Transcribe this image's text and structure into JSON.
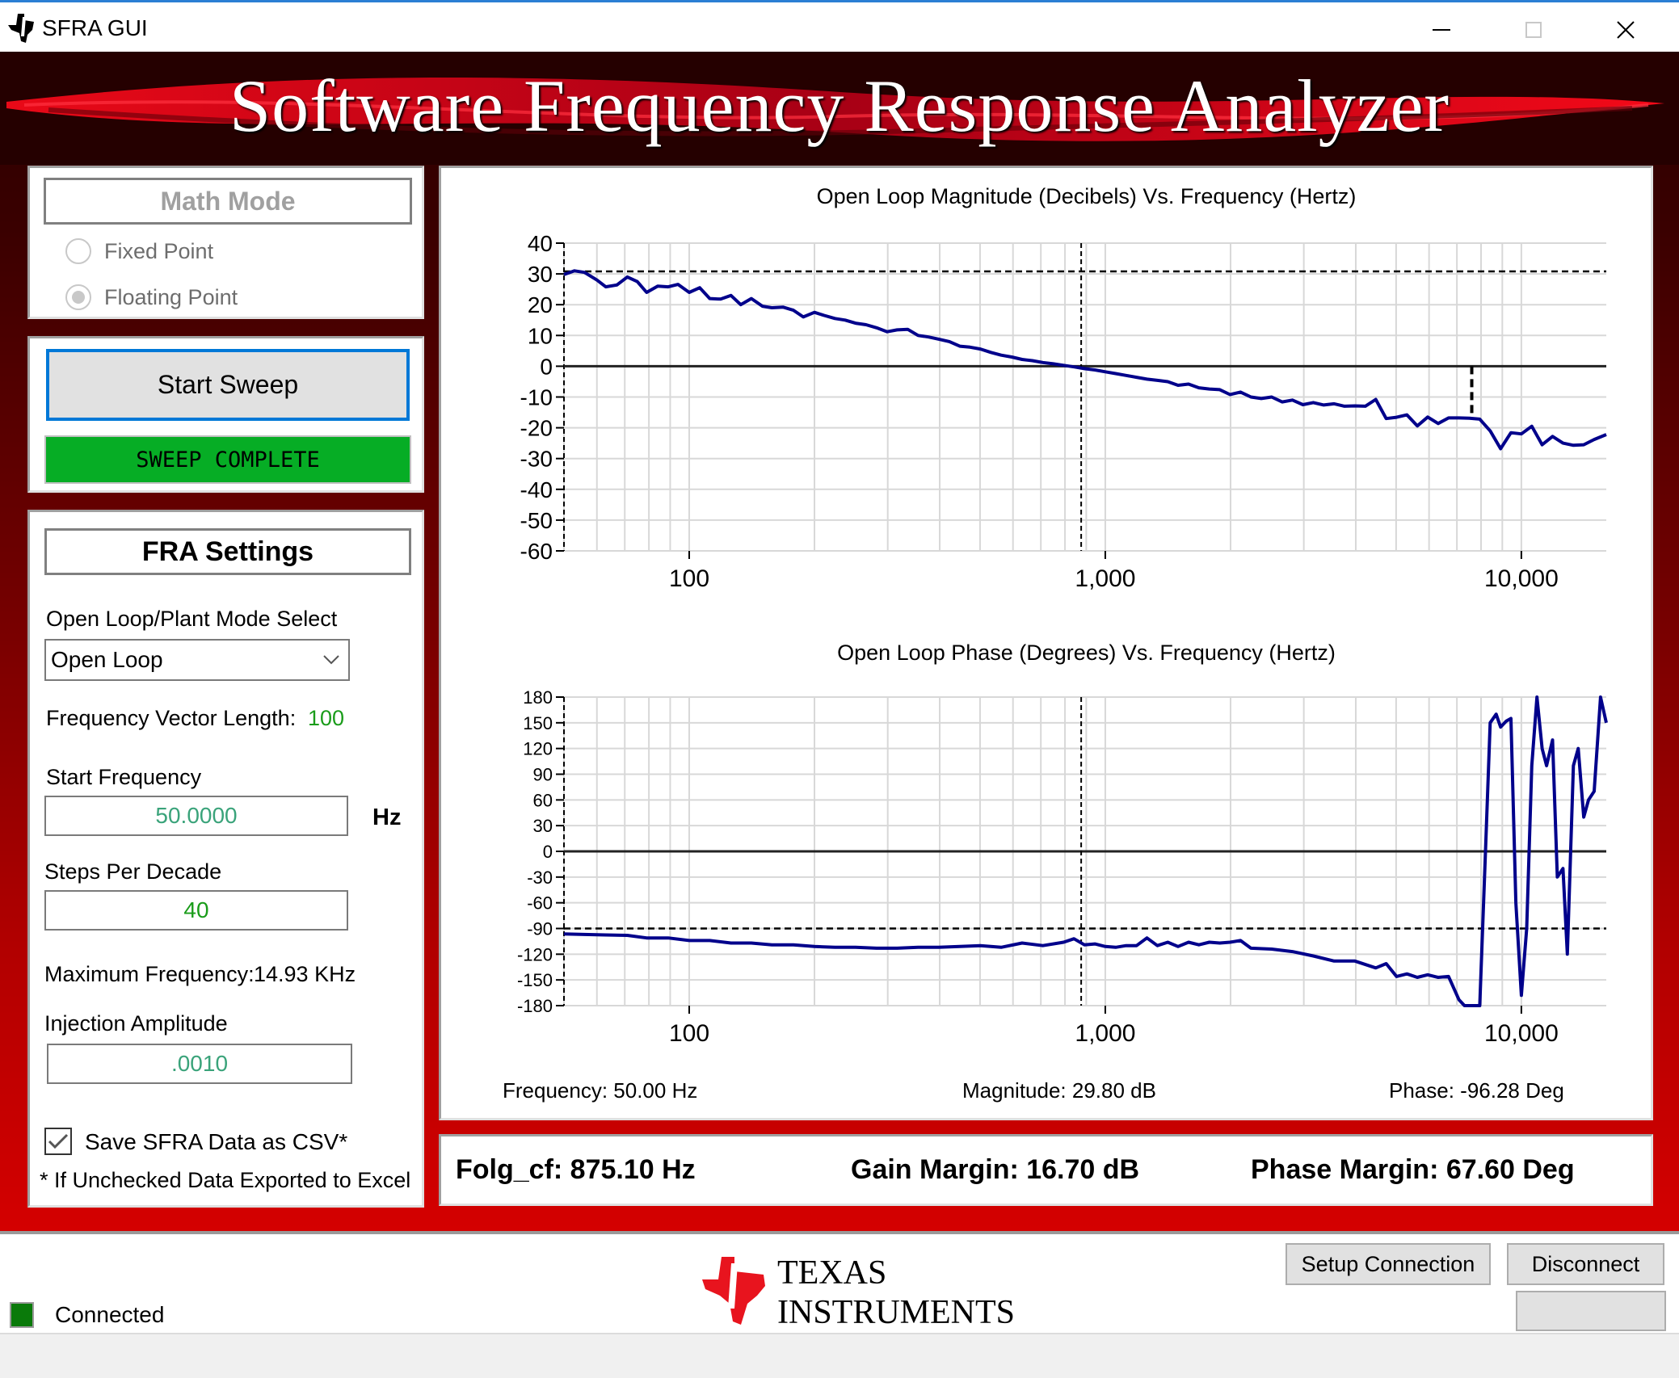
{
  "window": {
    "title": "SFRA GUI",
    "icon": "ti-logo-icon",
    "controls": [
      "minimize-icon",
      "maximize-icon",
      "close-icon"
    ]
  },
  "banner": {
    "title": "Software Frequency Response Analyzer"
  },
  "math_mode": {
    "title": "Math Mode",
    "options": [
      {
        "label": "Fixed Point",
        "selected": false
      },
      {
        "label": "Floating Point",
        "selected": true
      }
    ]
  },
  "sweep": {
    "start_label": "Start Sweep",
    "status": "SWEEP COMPLETE",
    "status_color": "#06ad25"
  },
  "fra_settings": {
    "title": "FRA Settings",
    "mode_label": "Open Loop/Plant Mode Select",
    "mode_value": "Open Loop",
    "vector_length_label": "Frequency Vector Length:",
    "vector_length_value": "100",
    "start_freq_label": "Start Frequency",
    "start_freq_value": "50.0000",
    "start_freq_unit": "Hz",
    "steps_label": "Steps Per Decade",
    "steps_value": "40",
    "max_freq_label": "Maximum Frequency:",
    "max_freq_value": "14.93 KHz",
    "injection_label": "Injection Amplitude",
    "injection_value": ".0010",
    "save_csv_label": "Save SFRA Data as CSV*",
    "save_csv_checked": true,
    "footnote": "* If Unchecked Data Exported to Excel"
  },
  "readouts": {
    "frequency": "Frequency: 50.00 Hz",
    "magnitude": "Magnitude: 29.80 dB",
    "phase": "Phase: -96.28 Deg"
  },
  "summary": {
    "folg_cf": "Folg_cf: 875.10 Hz",
    "gain_margin": "Gain Margin: 16.70 dB",
    "phase_margin": "Phase Margin: 67.60 Deg"
  },
  "status": {
    "connection": "Connected",
    "led_color": "#0a7a0a",
    "setup_label": "Setup Connection",
    "disconnect_label": "Disconnect",
    "blank_label": ""
  },
  "logo": {
    "line1": "Texas",
    "line2": "Instruments"
  },
  "chart_data": [
    {
      "type": "line",
      "title": "Open Loop Magnitude (Decibels) Vs. Frequency (Hertz)",
      "xscale": "log",
      "xlim": [
        50,
        16000
      ],
      "ylim": [
        -60,
        40
      ],
      "yticks": [
        40,
        30,
        20,
        10,
        0,
        -10,
        -20,
        -30,
        -40,
        -50,
        -60
      ],
      "xticks": [
        100,
        1000,
        10000
      ],
      "xtick_labels": [
        "100",
        "1,000",
        "10,000"
      ],
      "grid": true,
      "line_color": "#00008b",
      "reference_lines": {
        "horizontal_dashed": 30.8,
        "vertical_dashed": 875.1,
        "zero_line": 0,
        "gain_margin_marker_x": 7600,
        "gain_margin_marker_y": [
          0,
          -16.7
        ]
      },
      "series": [
        {
          "name": "Magnitude",
          "x": [
            50,
            53,
            56,
            60,
            63,
            67,
            71,
            75,
            79,
            84,
            89,
            94,
            100,
            106,
            112,
            119,
            126,
            133,
            141,
            150,
            158,
            168,
            178,
            188,
            200,
            211,
            224,
            237,
            251,
            266,
            282,
            299,
            316,
            335,
            355,
            376,
            398,
            422,
            447,
            473,
            501,
            531,
            562,
            596,
            631,
            668,
            708,
            750,
            794,
            841,
            891,
            944,
            1000,
            1059,
            1122,
            1189,
            1259,
            1334,
            1413,
            1496,
            1585,
            1679,
            1778,
            1884,
            1995,
            2113,
            2239,
            2371,
            2512,
            2661,
            2818,
            2985,
            3162,
            3350,
            3548,
            3758,
            3981,
            4217,
            4467,
            4732,
            5012,
            5309,
            5623,
            5957,
            6310,
            6683,
            7079,
            7499,
            7943,
            8414,
            8913,
            9441,
            10000,
            10593,
            11220,
            11885,
            12589,
            13335,
            14125,
            14962,
            16000
          ],
          "y": [
            29.8,
            31,
            30.5,
            28,
            25.8,
            26.4,
            29,
            27.5,
            24,
            26,
            25.8,
            26.6,
            24,
            25.5,
            22,
            21.8,
            23,
            20,
            22,
            19.5,
            19,
            19.2,
            18.2,
            16,
            17.5,
            16.5,
            15.5,
            15,
            14,
            13.5,
            12.5,
            11.2,
            11.8,
            12,
            10,
            9.5,
            8.8,
            8,
            6.5,
            6.2,
            5.6,
            4.5,
            3.6,
            3,
            2.2,
            1.8,
            1.2,
            0.8,
            0.3,
            -0.2,
            -0.8,
            -1.2,
            -1.8,
            -2.4,
            -3,
            -3.6,
            -4.2,
            -4.6,
            -5,
            -6.2,
            -5.8,
            -7,
            -7.4,
            -7.6,
            -9.2,
            -8.4,
            -10,
            -10.5,
            -10,
            -11.6,
            -11,
            -12.5,
            -11.8,
            -12.6,
            -12.2,
            -13,
            -12.9,
            -13,
            -10.8,
            -17,
            -16.6,
            -15.8,
            -19.4,
            -16.5,
            -18.6,
            -16.8,
            -16.8,
            -16.9,
            -17.2,
            -21,
            -26.8,
            -21.6,
            -22,
            -19.5,
            -25.5,
            -22.8,
            -25,
            -25.7,
            -25.5,
            -23.8,
            -22.2
          ]
        }
      ]
    },
    {
      "type": "line",
      "title": "Open Loop Phase (Degrees) Vs. Frequency (Hertz)",
      "xscale": "log",
      "xlim": [
        50,
        16000
      ],
      "ylim": [
        -180,
        180
      ],
      "yticks": [
        180,
        150,
        120,
        90,
        60,
        30,
        0,
        -30,
        -60,
        -90,
        -120,
        -150,
        -180
      ],
      "xticks": [
        100,
        1000,
        10000
      ],
      "xtick_labels": [
        "100",
        "1,000",
        "10,000"
      ],
      "grid": true,
      "line_color": "#00008b",
      "reference_lines": {
        "horizontal_dashed": -90,
        "vertical_dashed": 875.1,
        "zero_line": 0
      },
      "series": [
        {
          "name": "Phase",
          "x": [
            50,
            56,
            63,
            71,
            79,
            89,
            100,
            112,
            126,
            141,
            158,
            178,
            200,
            224,
            251,
            282,
            316,
            355,
            398,
            447,
            501,
            562,
            631,
            708,
            794,
            841,
            891,
            944,
            1000,
            1059,
            1122,
            1189,
            1259,
            1334,
            1413,
            1496,
            1585,
            1679,
            1778,
            1884,
            1995,
            2113,
            2239,
            2512,
            2818,
            3162,
            3548,
            3981,
            4467,
            4732,
            5012,
            5309,
            5623,
            5957,
            6310,
            6683,
            7079,
            7300,
            7500,
            7700,
            7943,
            8200,
            8414,
            8700,
            8913,
            9200,
            9441,
            9700,
            10000,
            10300,
            10593,
            10900,
            11220,
            11500,
            11885,
            12200,
            12589,
            12900,
            13335,
            13700,
            14125,
            14500,
            14962,
            15500,
            16000
          ],
          "y": [
            -96.3,
            -97,
            -97.5,
            -98,
            -101,
            -101,
            -104,
            -104,
            -107,
            -107,
            -109,
            -109,
            -111,
            -112,
            -112,
            -113,
            -113,
            -112,
            -112,
            -111,
            -110,
            -112,
            -107,
            -110,
            -106,
            -102,
            -109,
            -108,
            -111,
            -112,
            -110,
            -110,
            -101,
            -110,
            -106,
            -111,
            -106,
            -109,
            -106,
            -107,
            -106,
            -104,
            -113,
            -114,
            -117,
            -122,
            -128,
            -128,
            -136,
            -131,
            -146,
            -143,
            -147,
            -144,
            -147,
            -146,
            -173,
            -180,
            -180,
            -180,
            -180,
            0,
            150,
            160,
            145,
            152,
            155,
            -60,
            -168,
            -90,
            100,
            180,
            120,
            100,
            130,
            -30,
            -20,
            -120,
            100,
            120,
            40,
            60,
            70,
            180,
            150
          ]
        }
      ]
    }
  ]
}
